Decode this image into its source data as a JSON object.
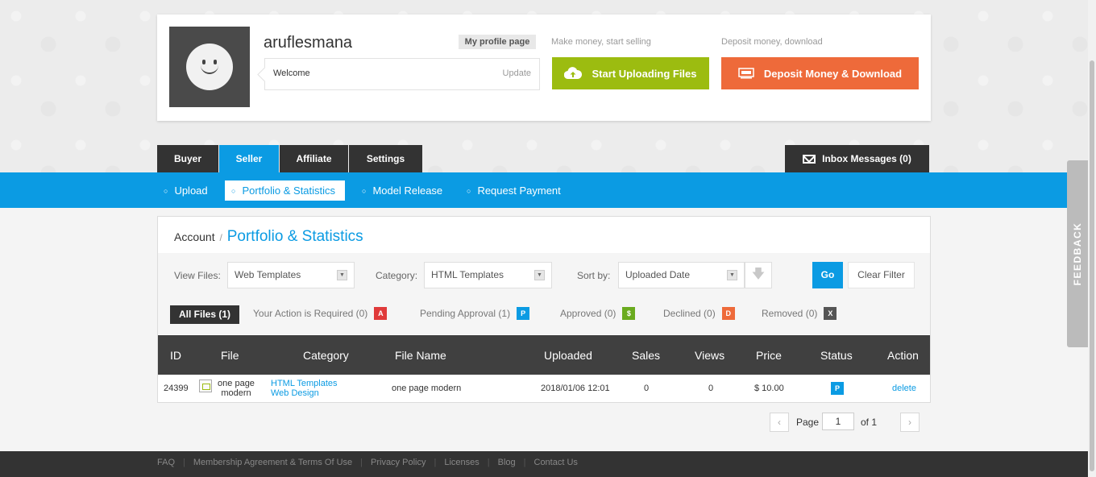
{
  "profile": {
    "username": "aruflesmana",
    "welcome_text": "Welcome",
    "update_label": "Update",
    "my_profile_label": "My profile page",
    "upload_caption": "Make money, start selling",
    "upload_button": "Start Uploading Files",
    "deposit_caption": "Deposit money, download",
    "deposit_button": "Deposit Money & Download"
  },
  "tabs": [
    {
      "label": "Buyer"
    },
    {
      "label": "Seller"
    },
    {
      "label": "Affiliate"
    },
    {
      "label": "Settings"
    }
  ],
  "inbox": {
    "label": "Inbox Messages (0)"
  },
  "subnav": [
    {
      "label": "Upload"
    },
    {
      "label": "Portfolio & Statistics"
    },
    {
      "label": "Model Release"
    },
    {
      "label": "Request Payment"
    }
  ],
  "breadcrumb": {
    "root": "Account",
    "separator": "/",
    "current": "Portfolio & Statistics"
  },
  "filters": {
    "view_label": "View Files:",
    "view_value": "Web Templates",
    "category_label": "Category:",
    "category_value": "HTML Templates",
    "sort_label": "Sort by:",
    "sort_value": "Uploaded Date",
    "go_label": "Go",
    "clear_label": "Clear Filter"
  },
  "status_filters": {
    "all": "All Files (1)",
    "items": [
      {
        "label": "Your Action is Required (0)",
        "badge": "A",
        "color": "#e03a3a"
      },
      {
        "label": "Pending Approval (1)",
        "badge": "P",
        "color": "#0b9be3"
      },
      {
        "label": "Approved (0)",
        "badge": "$",
        "color": "#6aab1f"
      },
      {
        "label": "Declined (0)",
        "badge": "D",
        "color": "#ee6a3a"
      },
      {
        "label": "Removed (0)",
        "badge": "X",
        "color": "#555555"
      }
    ]
  },
  "table": {
    "headers": [
      "ID",
      "File",
      "Category",
      "File Name",
      "Uploaded",
      "Sales",
      "Views",
      "Price",
      "Status",
      "Action"
    ],
    "rows": [
      {
        "id": "24399",
        "file_alt_line1": "one page",
        "file_alt_line2": "modern",
        "category_1": "HTML Templates",
        "category_2": "Web Design",
        "file_name": "one page modern",
        "uploaded": "2018/01/06 12:01",
        "sales": "0",
        "views": "0",
        "price": "$ 10.00",
        "status": "P",
        "action": "delete"
      }
    ]
  },
  "pagination": {
    "page_label": "Page",
    "page_value": "1",
    "of_label": "of 1"
  },
  "footer": {
    "links": [
      "FAQ",
      "Membership Agreement & Terms Of Use",
      "Privacy Policy",
      "Licenses",
      "Blog",
      "Contact Us"
    ]
  },
  "feedback": {
    "label": "FEEDBACK"
  },
  "colors": {
    "primary": "#0b9be3",
    "upload_green": "#9cbc10",
    "deposit_orange": "#ee6a3a",
    "dark": "#333333"
  }
}
